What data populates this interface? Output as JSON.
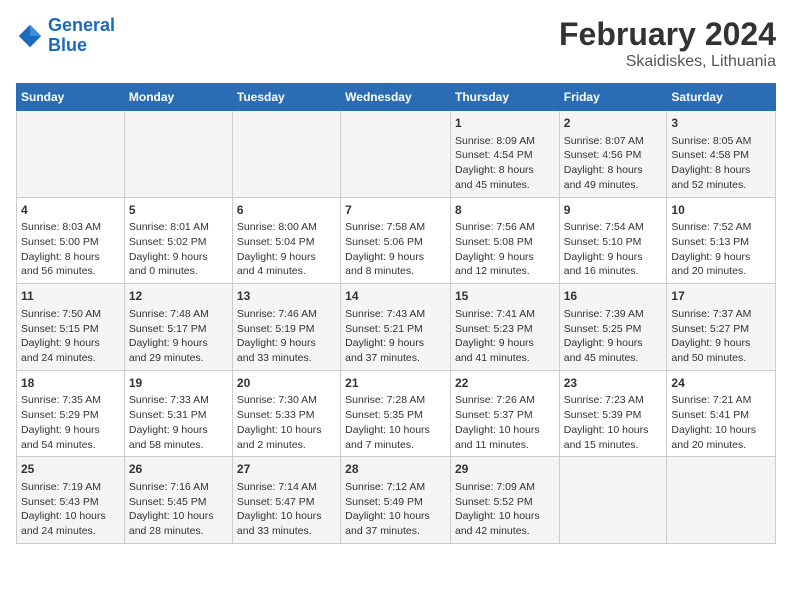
{
  "header": {
    "logo_line1": "General",
    "logo_line2": "Blue",
    "title": "February 2024",
    "subtitle": "Skaidiskes, Lithuania"
  },
  "weekdays": [
    "Sunday",
    "Monday",
    "Tuesday",
    "Wednesday",
    "Thursday",
    "Friday",
    "Saturday"
  ],
  "weeks": [
    [
      {
        "day": "",
        "info": ""
      },
      {
        "day": "",
        "info": ""
      },
      {
        "day": "",
        "info": ""
      },
      {
        "day": "",
        "info": ""
      },
      {
        "day": "1",
        "info": "Sunrise: 8:09 AM\nSunset: 4:54 PM\nDaylight: 8 hours\nand 45 minutes."
      },
      {
        "day": "2",
        "info": "Sunrise: 8:07 AM\nSunset: 4:56 PM\nDaylight: 8 hours\nand 49 minutes."
      },
      {
        "day": "3",
        "info": "Sunrise: 8:05 AM\nSunset: 4:58 PM\nDaylight: 8 hours\nand 52 minutes."
      }
    ],
    [
      {
        "day": "4",
        "info": "Sunrise: 8:03 AM\nSunset: 5:00 PM\nDaylight: 8 hours\nand 56 minutes."
      },
      {
        "day": "5",
        "info": "Sunrise: 8:01 AM\nSunset: 5:02 PM\nDaylight: 9 hours\nand 0 minutes."
      },
      {
        "day": "6",
        "info": "Sunrise: 8:00 AM\nSunset: 5:04 PM\nDaylight: 9 hours\nand 4 minutes."
      },
      {
        "day": "7",
        "info": "Sunrise: 7:58 AM\nSunset: 5:06 PM\nDaylight: 9 hours\nand 8 minutes."
      },
      {
        "day": "8",
        "info": "Sunrise: 7:56 AM\nSunset: 5:08 PM\nDaylight: 9 hours\nand 12 minutes."
      },
      {
        "day": "9",
        "info": "Sunrise: 7:54 AM\nSunset: 5:10 PM\nDaylight: 9 hours\nand 16 minutes."
      },
      {
        "day": "10",
        "info": "Sunrise: 7:52 AM\nSunset: 5:13 PM\nDaylight: 9 hours\nand 20 minutes."
      }
    ],
    [
      {
        "day": "11",
        "info": "Sunrise: 7:50 AM\nSunset: 5:15 PM\nDaylight: 9 hours\nand 24 minutes."
      },
      {
        "day": "12",
        "info": "Sunrise: 7:48 AM\nSunset: 5:17 PM\nDaylight: 9 hours\nand 29 minutes."
      },
      {
        "day": "13",
        "info": "Sunrise: 7:46 AM\nSunset: 5:19 PM\nDaylight: 9 hours\nand 33 minutes."
      },
      {
        "day": "14",
        "info": "Sunrise: 7:43 AM\nSunset: 5:21 PM\nDaylight: 9 hours\nand 37 minutes."
      },
      {
        "day": "15",
        "info": "Sunrise: 7:41 AM\nSunset: 5:23 PM\nDaylight: 9 hours\nand 41 minutes."
      },
      {
        "day": "16",
        "info": "Sunrise: 7:39 AM\nSunset: 5:25 PM\nDaylight: 9 hours\nand 45 minutes."
      },
      {
        "day": "17",
        "info": "Sunrise: 7:37 AM\nSunset: 5:27 PM\nDaylight: 9 hours\nand 50 minutes."
      }
    ],
    [
      {
        "day": "18",
        "info": "Sunrise: 7:35 AM\nSunset: 5:29 PM\nDaylight: 9 hours\nand 54 minutes."
      },
      {
        "day": "19",
        "info": "Sunrise: 7:33 AM\nSunset: 5:31 PM\nDaylight: 9 hours\nand 58 minutes."
      },
      {
        "day": "20",
        "info": "Sunrise: 7:30 AM\nSunset: 5:33 PM\nDaylight: 10 hours\nand 2 minutes."
      },
      {
        "day": "21",
        "info": "Sunrise: 7:28 AM\nSunset: 5:35 PM\nDaylight: 10 hours\nand 7 minutes."
      },
      {
        "day": "22",
        "info": "Sunrise: 7:26 AM\nSunset: 5:37 PM\nDaylight: 10 hours\nand 11 minutes."
      },
      {
        "day": "23",
        "info": "Sunrise: 7:23 AM\nSunset: 5:39 PM\nDaylight: 10 hours\nand 15 minutes."
      },
      {
        "day": "24",
        "info": "Sunrise: 7:21 AM\nSunset: 5:41 PM\nDaylight: 10 hours\nand 20 minutes."
      }
    ],
    [
      {
        "day": "25",
        "info": "Sunrise: 7:19 AM\nSunset: 5:43 PM\nDaylight: 10 hours\nand 24 minutes."
      },
      {
        "day": "26",
        "info": "Sunrise: 7:16 AM\nSunset: 5:45 PM\nDaylight: 10 hours\nand 28 minutes."
      },
      {
        "day": "27",
        "info": "Sunrise: 7:14 AM\nSunset: 5:47 PM\nDaylight: 10 hours\nand 33 minutes."
      },
      {
        "day": "28",
        "info": "Sunrise: 7:12 AM\nSunset: 5:49 PM\nDaylight: 10 hours\nand 37 minutes."
      },
      {
        "day": "29",
        "info": "Sunrise: 7:09 AM\nSunset: 5:52 PM\nDaylight: 10 hours\nand 42 minutes."
      },
      {
        "day": "",
        "info": ""
      },
      {
        "day": "",
        "info": ""
      }
    ]
  ]
}
